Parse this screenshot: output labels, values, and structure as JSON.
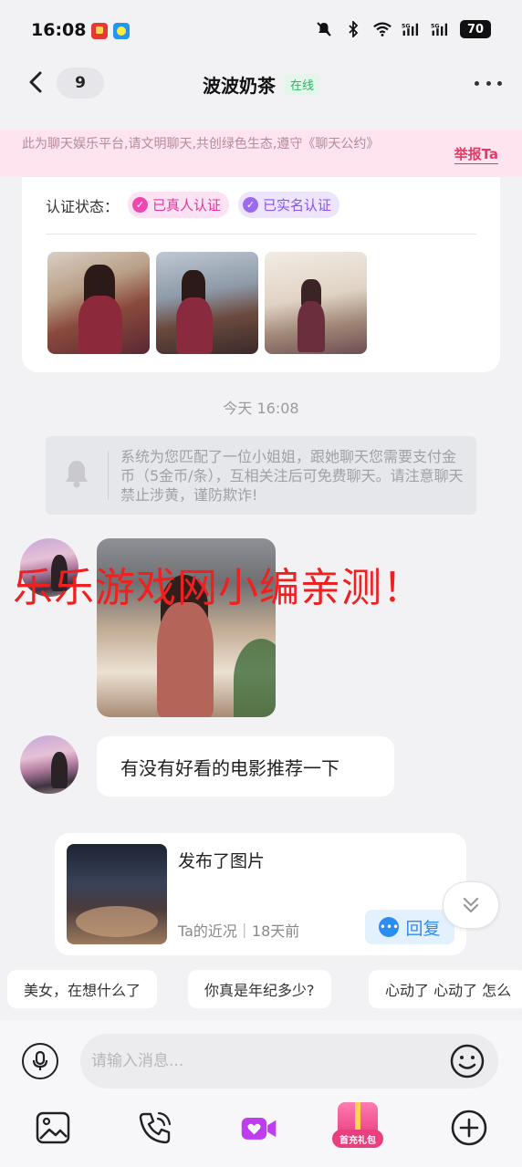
{
  "status_bar": {
    "time": "16:08",
    "battery": "70",
    "icons": [
      "mute-icon",
      "bluetooth-icon",
      "wifi-icon",
      "5g-signal-icon",
      "5g-signal-icon",
      "battery-icon"
    ]
  },
  "header": {
    "unread_count": "9",
    "contact_name": "波波奶茶",
    "online_status": "在线"
  },
  "notice": {
    "text": "此为聊天娱乐平台,请文明聊天,共创绿色生态,遵守《聊天公约》",
    "report_label": "举报Ta"
  },
  "profile_card": {
    "verify_label": "认证状态：",
    "badges": [
      "已真人认证",
      "已实名认证"
    ]
  },
  "chat": {
    "time_divider": "今天 16:08",
    "system_message": "系统为您匹配了一位小姐姐，跟她聊天您需要支付金币（5金币/条），互相关注后可免费聊天。请注意聊天禁止涉黄，谨防欺诈!",
    "text_message": "有没有好看的电影推荐一下"
  },
  "moment_card": {
    "title": "发布了图片",
    "meta": "Ta的近况｜18天前",
    "reply_label": "回复"
  },
  "quick_replies": [
    "美女，在想什么了",
    "你真是年纪多少?",
    "心动了 心动了 怎么"
  ],
  "input": {
    "placeholder": "请输入消息..."
  },
  "toolbar": {
    "gift_label": "首充礼包"
  },
  "watermark": "乐乐游戏网小编亲测！",
  "colors": {
    "accent_pink": "#e53a68",
    "online_green": "#2cb36a",
    "reply_blue": "#2d8cf0",
    "video_purple": "#c03cf0",
    "watermark_red": "#f02020"
  }
}
